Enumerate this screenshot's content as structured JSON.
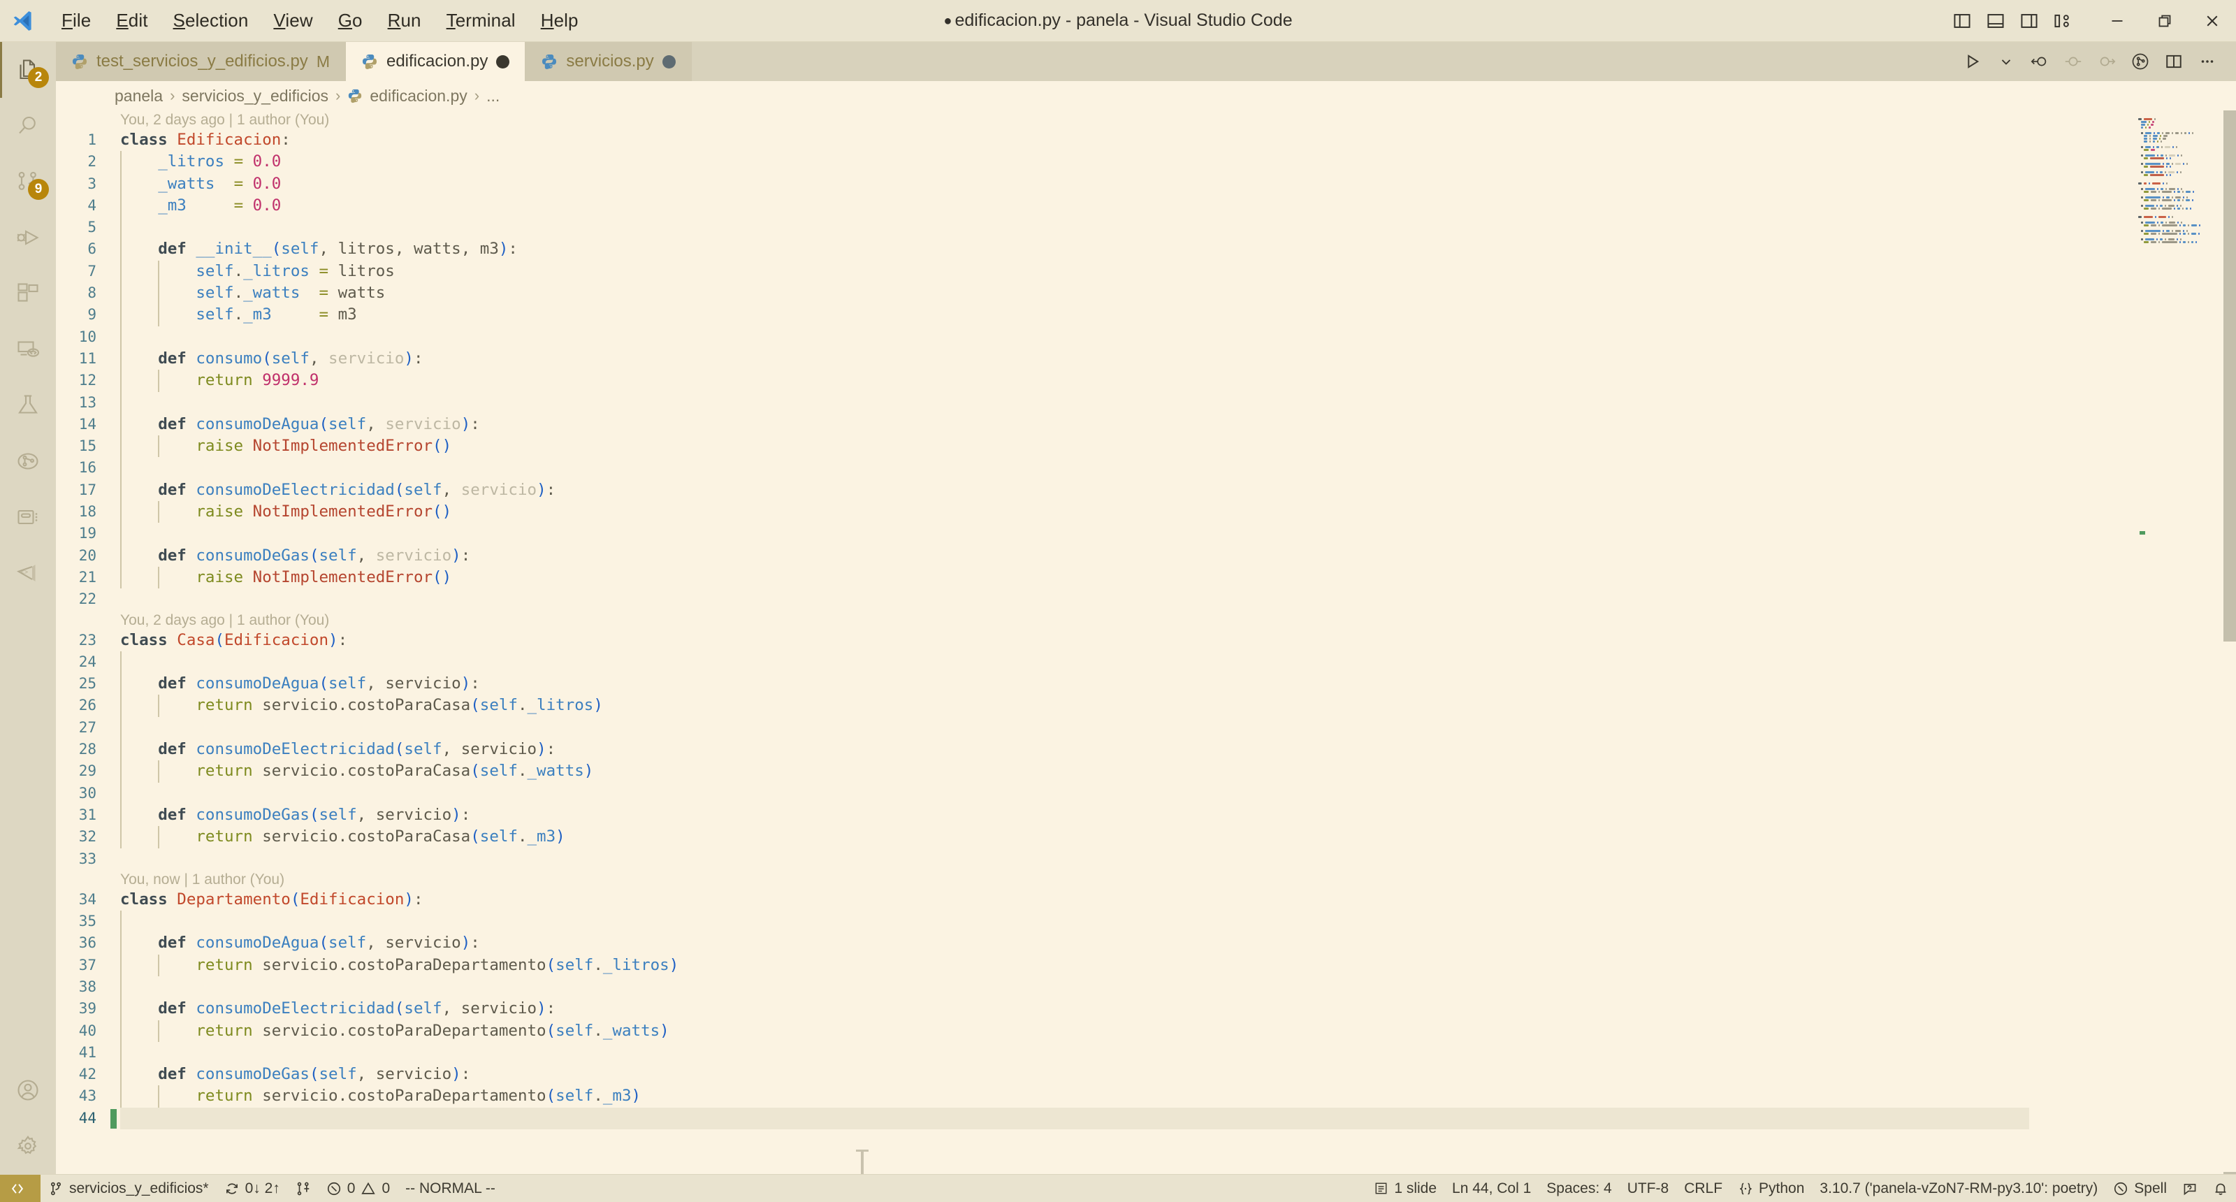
{
  "titlebar": {
    "title": "edificacion.py - panela - Visual Studio Code",
    "dirty_marker": "●",
    "menus": [
      {
        "label": "File",
        "accel": "F"
      },
      {
        "label": "Edit",
        "accel": "E"
      },
      {
        "label": "Selection",
        "accel": "S"
      },
      {
        "label": "View",
        "accel": "V"
      },
      {
        "label": "Go",
        "accel": "G"
      },
      {
        "label": "Run",
        "accel": "R"
      },
      {
        "label": "Terminal",
        "accel": "T"
      },
      {
        "label": "Help",
        "accel": "H"
      }
    ],
    "layout_buttons": [
      "toggle-primary-sidebar",
      "toggle-panel",
      "toggle-secondary-sidebar",
      "customize-layout"
    ],
    "window_buttons": [
      "minimize",
      "restore",
      "close"
    ]
  },
  "activitybar": {
    "items": [
      {
        "name": "explorer",
        "icon": "files-icon",
        "badge": "2",
        "active": true
      },
      {
        "name": "search",
        "icon": "search-icon",
        "badge": ""
      },
      {
        "name": "source-control",
        "icon": "source-control-icon",
        "badge": "9"
      },
      {
        "name": "run-and-debug",
        "icon": "debug-icon",
        "badge": ""
      },
      {
        "name": "extensions",
        "icon": "extensions-icon",
        "badge": ""
      },
      {
        "name": "remote-explorer",
        "icon": "remote-explorer-icon",
        "badge": ""
      },
      {
        "name": "testing",
        "icon": "beaker-icon",
        "badge": ""
      },
      {
        "name": "git-graph",
        "icon": "git-graph-icon",
        "badge": ""
      },
      {
        "name": "database",
        "icon": "database-icon",
        "badge": ""
      },
      {
        "name": "code-snippets",
        "icon": "code-panel-icon",
        "badge": ""
      }
    ],
    "bottom_items": [
      {
        "name": "accounts",
        "icon": "account-icon"
      },
      {
        "name": "manage-settings",
        "icon": "gear-icon"
      }
    ]
  },
  "tabs": [
    {
      "label": "test_servicios_y_edificios.py",
      "icon": "python-icon",
      "modified_letter": "M",
      "dirty": false,
      "active": false
    },
    {
      "label": "edificacion.py",
      "icon": "python-icon",
      "modified_letter": "",
      "dirty": true,
      "active": true
    },
    {
      "label": "servicios.py",
      "icon": "python-icon",
      "modified_letter": "",
      "dirty": true,
      "active": false
    }
  ],
  "editor_actions": [
    {
      "name": "run-python-file",
      "icon": "play-icon"
    },
    {
      "name": "run-dropdown",
      "icon": "chevron-down-icon"
    },
    {
      "name": "step-back",
      "icon": "step-back-icon"
    },
    {
      "name": "step-current",
      "icon": "step-current-icon"
    },
    {
      "name": "step-forward",
      "icon": "step-forward-icon"
    },
    {
      "name": "git-graph-action",
      "icon": "git-graph-circle-icon"
    },
    {
      "name": "split-editor",
      "icon": "split-editor-icon"
    },
    {
      "name": "more-actions",
      "icon": "ellipsis-icon"
    }
  ],
  "breadcrumbs": [
    {
      "label": "panela",
      "icon": ""
    },
    {
      "label": "servicios_y_edificios",
      "icon": ""
    },
    {
      "label": "edificacion.py",
      "icon": "python-icon"
    },
    {
      "label": "...",
      "icon": ""
    }
  ],
  "editor": {
    "active_line": 44,
    "blame_annotations": {
      "1": "You, 2 days ago | 1 author (You)",
      "23": "You, 2 days ago | 1 author (You)",
      "34": "You, now | 1 author (You)"
    },
    "lines": [
      {
        "n": 1,
        "text": "class Edificacion:"
      },
      {
        "n": 2,
        "text": "    _litros = 0.0"
      },
      {
        "n": 3,
        "text": "    _watts  = 0.0"
      },
      {
        "n": 4,
        "text": "    _m3     = 0.0"
      },
      {
        "n": 5,
        "text": ""
      },
      {
        "n": 6,
        "text": "    def __init__(self, litros, watts, m3):"
      },
      {
        "n": 7,
        "text": "        self._litros = litros"
      },
      {
        "n": 8,
        "text": "        self._watts  = watts"
      },
      {
        "n": 9,
        "text": "        self._m3     = m3"
      },
      {
        "n": 10,
        "text": ""
      },
      {
        "n": 11,
        "text": "    def consumo(self, servicio):"
      },
      {
        "n": 12,
        "text": "        return 9999.9"
      },
      {
        "n": 13,
        "text": ""
      },
      {
        "n": 14,
        "text": "    def consumoDeAgua(self, servicio):"
      },
      {
        "n": 15,
        "text": "        raise NotImplementedError()"
      },
      {
        "n": 16,
        "text": ""
      },
      {
        "n": 17,
        "text": "    def consumoDeElectricidad(self, servicio):"
      },
      {
        "n": 18,
        "text": "        raise NotImplementedError()"
      },
      {
        "n": 19,
        "text": ""
      },
      {
        "n": 20,
        "text": "    def consumoDeGas(self, servicio):"
      },
      {
        "n": 21,
        "text": "        raise NotImplementedError()"
      },
      {
        "n": 22,
        "text": ""
      },
      {
        "n": 23,
        "text": "class Casa(Edificacion):"
      },
      {
        "n": 24,
        "text": ""
      },
      {
        "n": 25,
        "text": "    def consumoDeAgua(self, servicio):"
      },
      {
        "n": 26,
        "text": "        return servicio.costoParaCasa(self._litros)"
      },
      {
        "n": 27,
        "text": ""
      },
      {
        "n": 28,
        "text": "    def consumoDeElectricidad(self, servicio):"
      },
      {
        "n": 29,
        "text": "        return servicio.costoParaCasa(self._watts)"
      },
      {
        "n": 30,
        "text": ""
      },
      {
        "n": 31,
        "text": "    def consumoDeGas(self, servicio):"
      },
      {
        "n": 32,
        "text": "        return servicio.costoParaCasa(self._m3)"
      },
      {
        "n": 33,
        "text": ""
      },
      {
        "n": 34,
        "text": "class Departamento(Edificacion):"
      },
      {
        "n": 35,
        "text": ""
      },
      {
        "n": 36,
        "text": "    def consumoDeAgua(self, servicio):"
      },
      {
        "n": 37,
        "text": "        return servicio.costoParaDepartamento(self._litros)"
      },
      {
        "n": 38,
        "text": ""
      },
      {
        "n": 39,
        "text": "    def consumoDeElectricidad(self, servicio):"
      },
      {
        "n": 40,
        "text": "        return servicio.costoParaDepartamento(self._watts)"
      },
      {
        "n": 41,
        "text": ""
      },
      {
        "n": 42,
        "text": "    def consumoDeGas(self, servicio):"
      },
      {
        "n": 43,
        "text": "        return servicio.costoParaDepartamento(self._m3)"
      },
      {
        "n": 44,
        "text": ""
      }
    ]
  },
  "statusbar": {
    "left": [
      {
        "name": "remote-indicator",
        "icon": "remote-icon",
        "label": ""
      },
      {
        "name": "git-branch",
        "icon": "branch-icon",
        "label": "servicios_y_edificios*"
      },
      {
        "name": "git-sync",
        "icon": "sync-icon",
        "label": "0↓ 2↑"
      },
      {
        "name": "git-changes",
        "icon": "git-compare-icon",
        "label": ""
      },
      {
        "name": "problems",
        "icon": "error-warning-icon",
        "label": "0  0"
      },
      {
        "name": "vim-mode",
        "icon": "",
        "label": "-- NORMAL --"
      }
    ],
    "problems": {
      "errors": "0",
      "warnings": "0"
    },
    "right": [
      {
        "name": "slides",
        "icon": "slide-icon",
        "label": "1 slide"
      },
      {
        "name": "cursor-position",
        "icon": "",
        "label": "Ln 44, Col 1"
      },
      {
        "name": "indentation",
        "icon": "",
        "label": "Spaces: 4"
      },
      {
        "name": "encoding",
        "icon": "",
        "label": "UTF-8"
      },
      {
        "name": "eol",
        "icon": "",
        "label": "CRLF"
      },
      {
        "name": "language-mode",
        "icon": "python-brace-icon",
        "label": "Python"
      },
      {
        "name": "python-interpreter",
        "icon": "",
        "label": "3.10.7 ('panela-vZoN7-RM-py3.10': poetry)"
      },
      {
        "name": "spell-checker",
        "icon": "spell-icon",
        "label": "Spell"
      },
      {
        "name": "feedback",
        "icon": "feedback-icon",
        "label": ""
      },
      {
        "name": "notifications",
        "icon": "bell-icon",
        "label": ""
      }
    ]
  },
  "colors": {
    "titlebar_bg": "#EAE4D0",
    "activitybar_bg": "#DDD7C2",
    "tabbar_bg": "#D8D2BC",
    "editor_bg": "#FBF3E2",
    "statusbar_bg": "#E9E3CF",
    "badge_bg": "#B8860B",
    "remote_bg": "#B69C45",
    "cursor": "#4F9A5E",
    "current_line": "#EDE6D2"
  }
}
